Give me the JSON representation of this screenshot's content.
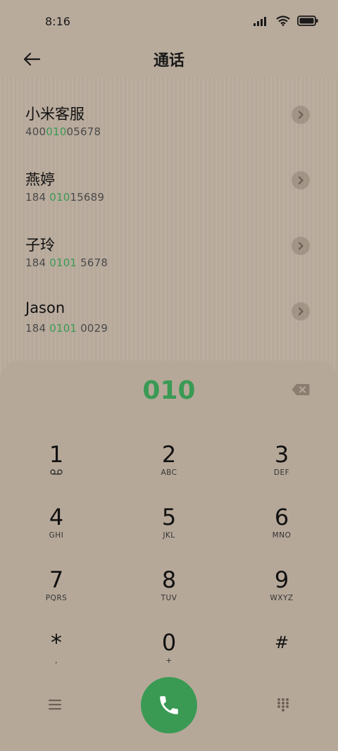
{
  "status": {
    "time": "8:16"
  },
  "header": {
    "title": "通话"
  },
  "results": [
    {
      "name": "小米客服",
      "num_pre": "400",
      "num_hl": "010",
      "num_post": "05678"
    },
    {
      "name": "燕婷",
      "num_pre": "184 ",
      "num_hl": "010",
      "num_post": "15689"
    },
    {
      "name": "子玲",
      "num_pre": "184 ",
      "num_hl": "0101",
      "num_post": " 5678"
    },
    {
      "name": "Jason",
      "num_pre": "184 ",
      "num_hl": "0101",
      "num_post": " 0029"
    }
  ],
  "dialpad": {
    "digits": "010",
    "keys": [
      {
        "n": "1",
        "s": ""
      },
      {
        "n": "2",
        "s": "ABC"
      },
      {
        "n": "3",
        "s": "DEF"
      },
      {
        "n": "4",
        "s": "GHI"
      },
      {
        "n": "5",
        "s": "JKL"
      },
      {
        "n": "6",
        "s": "MNO"
      },
      {
        "n": "7",
        "s": "PQRS"
      },
      {
        "n": "8",
        "s": "TUV"
      },
      {
        "n": "9",
        "s": "WXYZ"
      },
      {
        "n": "*",
        "s": ","
      },
      {
        "n": "0",
        "s": "+"
      },
      {
        "n": "#",
        "s": ""
      }
    ]
  },
  "colors": {
    "accent": "#3a9a54",
    "background": "#b9ab9c"
  },
  "icons": {
    "back": "arrow-left-icon",
    "call": "phone-icon",
    "menu": "menu-icon",
    "keypad": "dialpad-icon",
    "backspace": "backspace-icon"
  }
}
